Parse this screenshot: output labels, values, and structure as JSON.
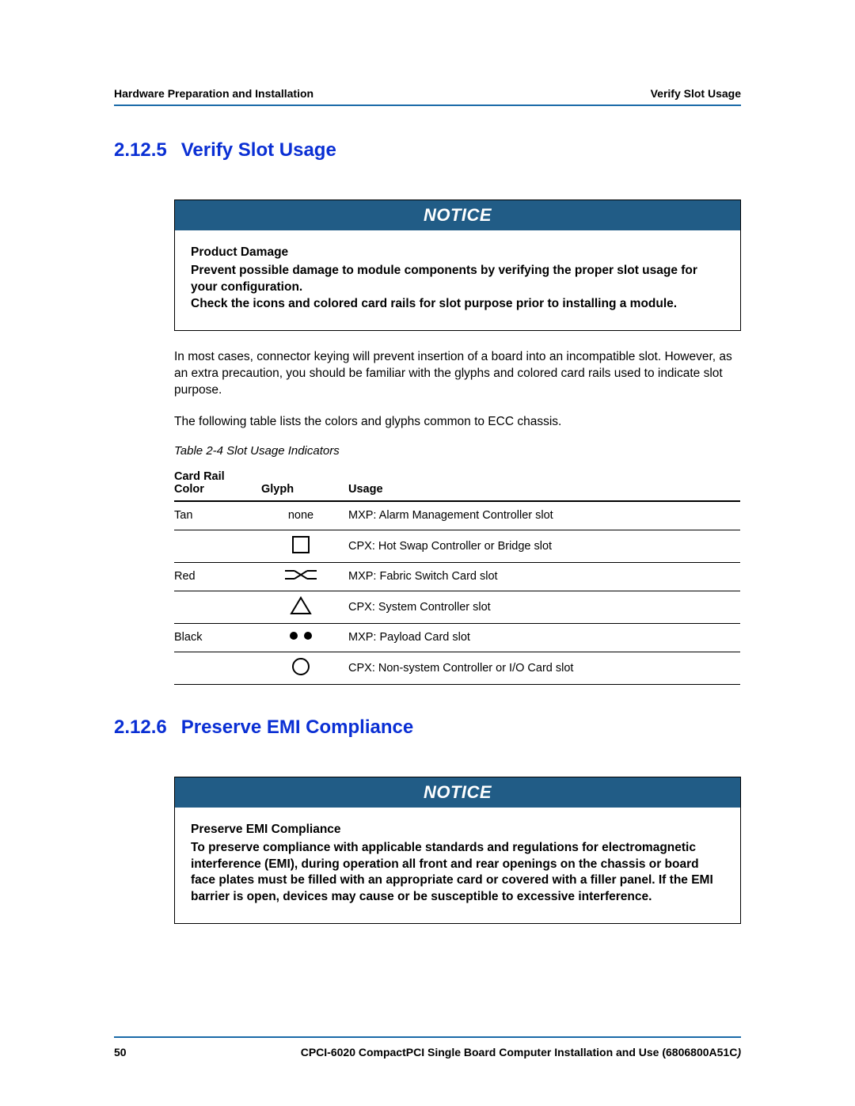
{
  "header": {
    "left": "Hardware Preparation and Installation",
    "right": "Verify Slot Usage"
  },
  "section1": {
    "number": "2.12.5",
    "title": "Verify Slot Usage",
    "notice_label": "NOTICE",
    "notice_title": "Product Damage",
    "notice_body_1": "Prevent possible damage to module components by verifying the proper slot usage for your configuration.",
    "notice_body_2": "Check the icons and colored card rails for slot purpose prior to installing a module.",
    "para1": "In most cases, connector keying will prevent insertion of a board into an incompatible slot. However, as an extra precaution, you should be familiar with the glyphs and colored card rails used to indicate slot purpose.",
    "para2": "The following table lists the colors and glyphs common to ECC chassis.",
    "table_caption": "Table 2-4 Slot Usage Indicators",
    "table_headers": {
      "color": "Card Rail Color",
      "glyph": "Glyph",
      "usage": "Usage"
    },
    "rows": [
      {
        "color": "Tan",
        "glyph_label": "none",
        "glyph_icon": "none",
        "usage": "MXP: Alarm Management Controller slot"
      },
      {
        "color": "",
        "glyph_label": "",
        "glyph_icon": "square",
        "usage": "CPX: Hot Swap Controller or Bridge slot"
      },
      {
        "color": "Red",
        "glyph_label": "",
        "glyph_icon": "crossover",
        "usage": "MXP: Fabric Switch Card slot"
      },
      {
        "color": "",
        "glyph_label": "",
        "glyph_icon": "triangle",
        "usage": "CPX: System Controller slot"
      },
      {
        "color": "Black",
        "glyph_label": "",
        "glyph_icon": "two-dots",
        "usage": "MXP: Payload Card slot"
      },
      {
        "color": "",
        "glyph_label": "",
        "glyph_icon": "circle",
        "usage": "CPX: Non-system Controller or I/O Card slot"
      }
    ]
  },
  "section2": {
    "number": "2.12.6",
    "title": "Preserve EMI Compliance",
    "notice_label": "NOTICE",
    "notice_title": "Preserve EMI Compliance",
    "notice_body": "To preserve compliance with applicable standards and regulations for electromagnetic interference (EMI), during operation all front and rear openings on the chassis or board face plates must be filled with an appropriate card or covered with a filler panel. If the EMI barrier is open, devices may cause or be susceptible to excessive interference."
  },
  "footer": {
    "page_number": "50",
    "doc_title": "CPCI-6020 CompactPCI Single Board Computer Installation and Use (6806800A51C",
    "doc_paren_close": ")"
  }
}
